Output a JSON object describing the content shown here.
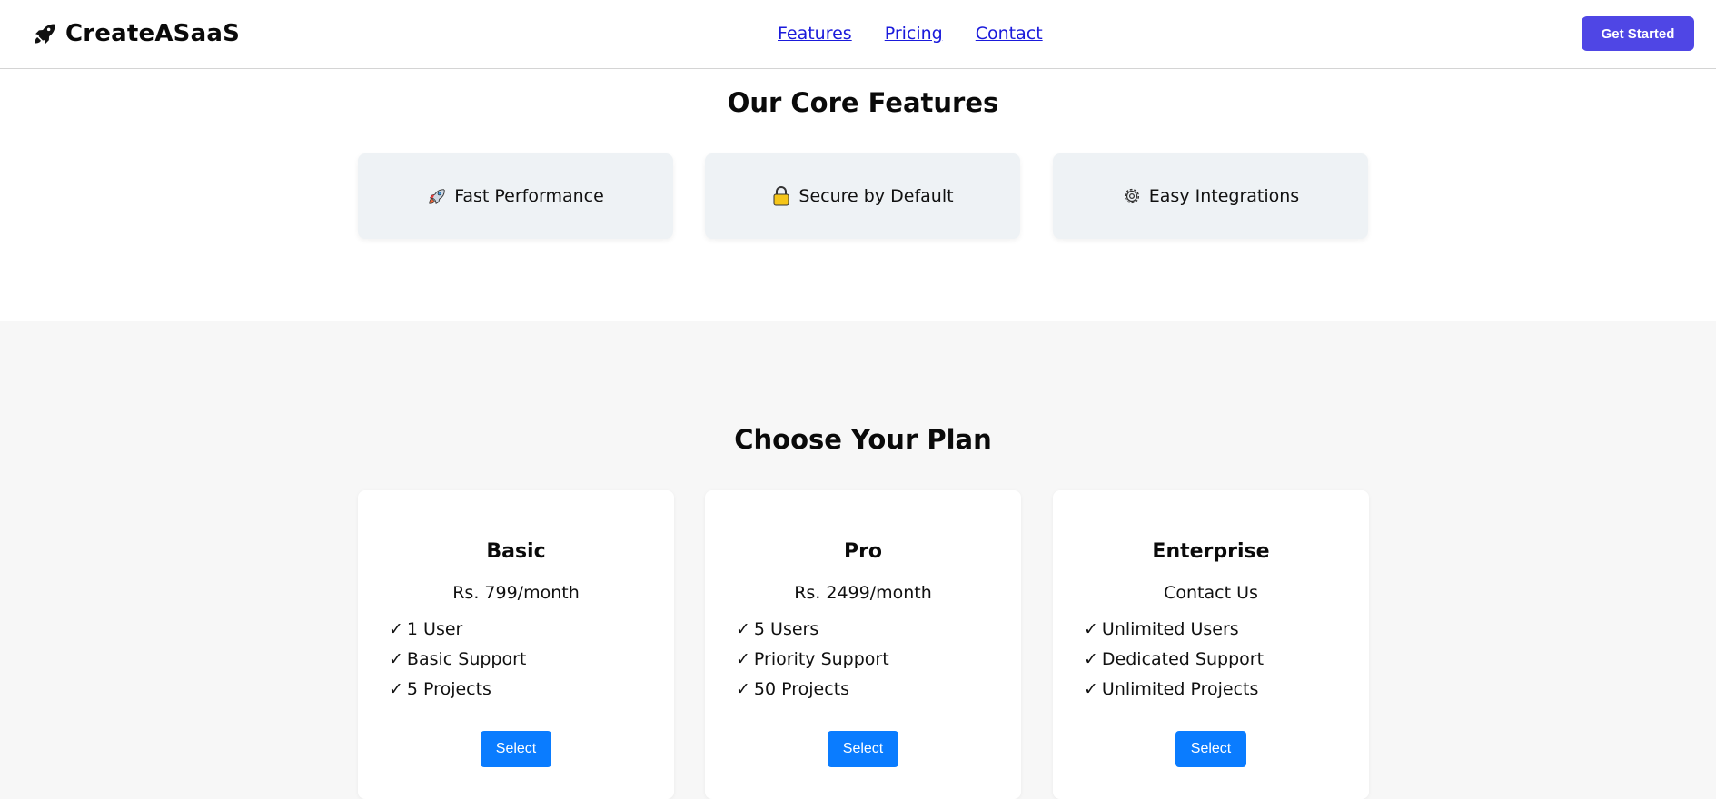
{
  "header": {
    "brand": "CreateASaaS",
    "logo_icon": "rocket-icon",
    "nav": [
      "Features",
      "Pricing",
      "Contact"
    ],
    "cta_label": "Get Started",
    "cta_color": "#4f46e5"
  },
  "features": {
    "title": "Our Core Features",
    "items": [
      {
        "icon": "rocket-icon",
        "label": "Fast Performance"
      },
      {
        "icon": "lock-icon",
        "label": "Secure by Default"
      },
      {
        "icon": "gear-icon",
        "label": "Easy Integrations"
      }
    ]
  },
  "pricing": {
    "title": "Choose Your Plan",
    "check_mark": "✓",
    "select_color": "#0a7cff",
    "plans": [
      {
        "name": "Basic",
        "price": "Rs. 799/month",
        "features": [
          "1 User",
          "Basic Support",
          "5 Projects"
        ],
        "button": "Select"
      },
      {
        "name": "Pro",
        "price": "Rs. 2499/month",
        "features": [
          "5 Users",
          "Priority Support",
          "50 Projects"
        ],
        "button": "Select"
      },
      {
        "name": "Enterprise",
        "price": "Contact Us",
        "features": [
          "Unlimited Users",
          "Dedicated Support",
          "Unlimited Projects"
        ],
        "button": "Select"
      }
    ]
  }
}
